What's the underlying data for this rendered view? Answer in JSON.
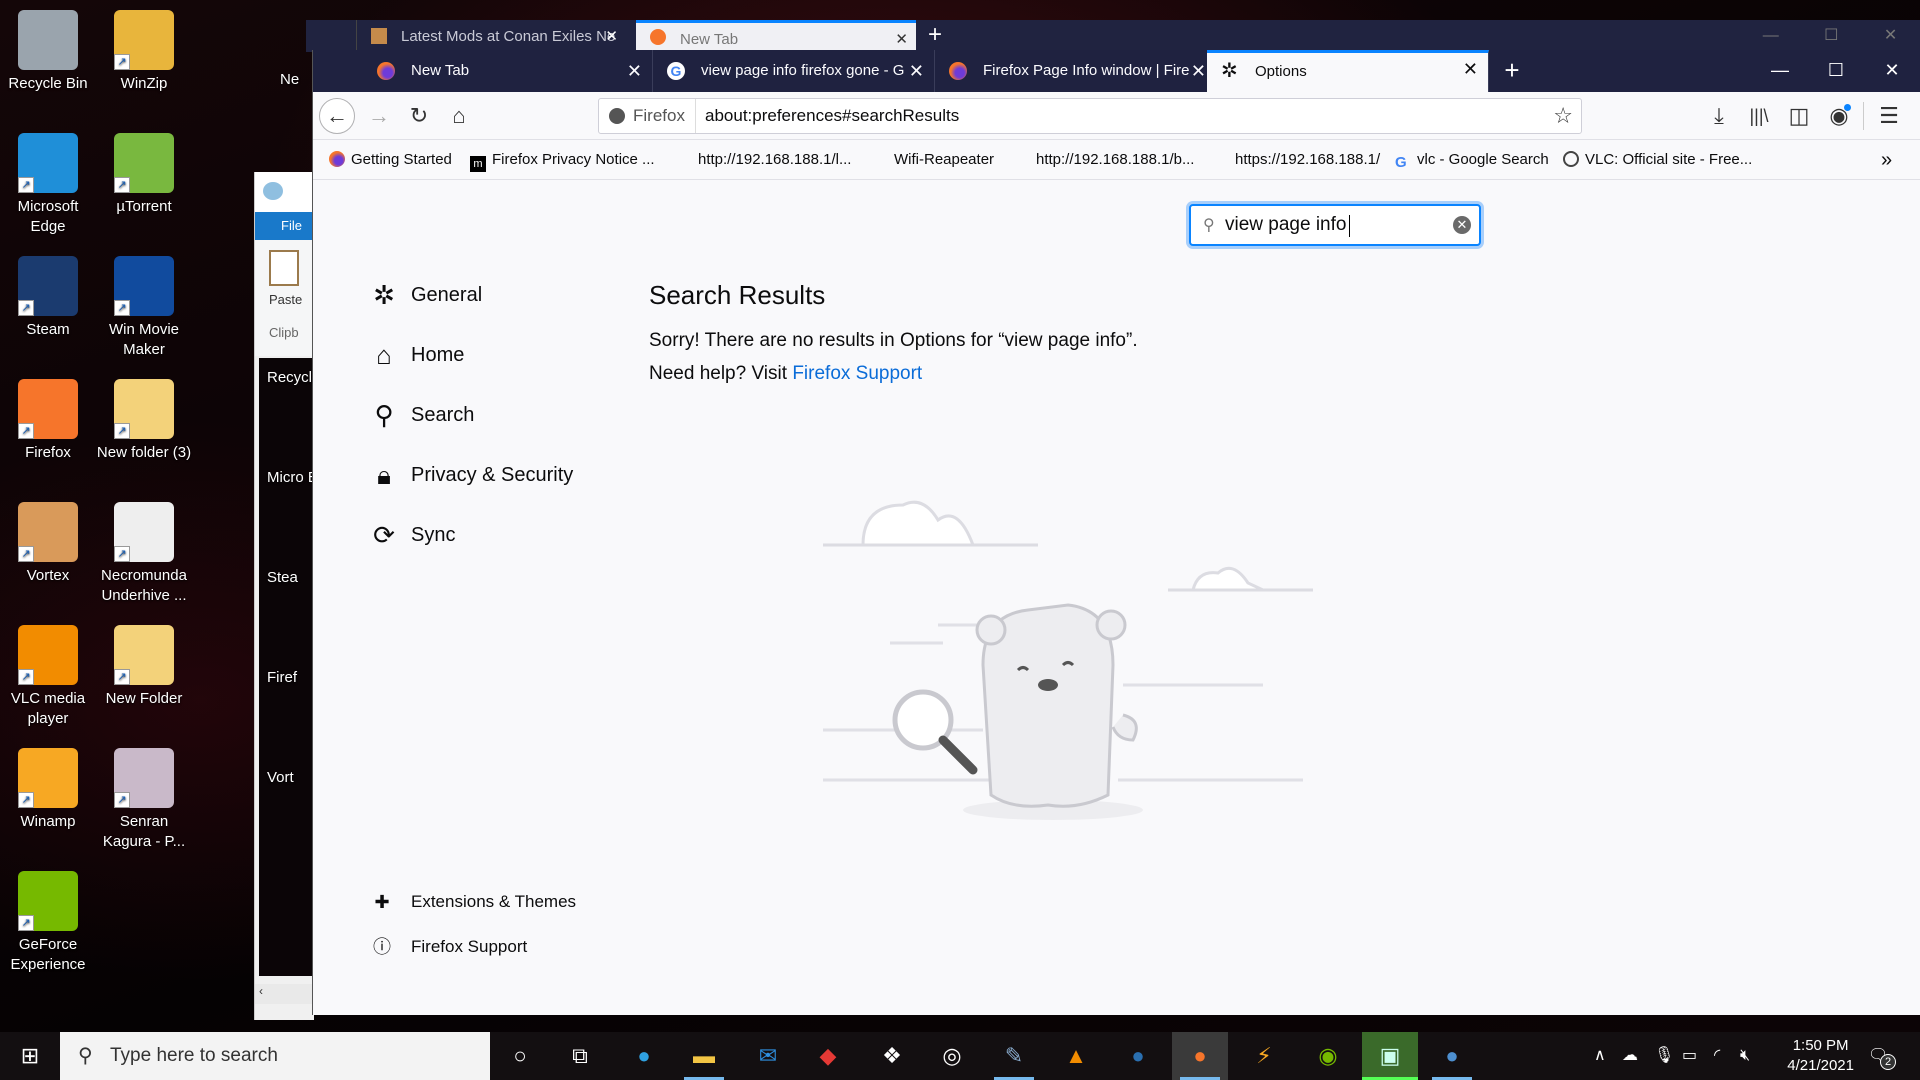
{
  "desktop": {
    "icons": [
      {
        "label": "Recycle Bin",
        "name": "recycle-bin"
      },
      {
        "label": "WinZip",
        "name": "winzip"
      },
      {
        "label": "Microsoft Edge",
        "name": "microsoft-edge"
      },
      {
        "label": "µTorrent",
        "name": "utorrent"
      },
      {
        "label": "Steam",
        "name": "steam"
      },
      {
        "label": "Win Movie Maker",
        "name": "win-movie-maker"
      },
      {
        "label": "Firefox",
        "name": "firefox"
      },
      {
        "label": "New folder (3)",
        "name": "new-folder-3"
      },
      {
        "label": "Vortex",
        "name": "vortex"
      },
      {
        "label": "Necromunda Underhive ...",
        "name": "necromunda"
      },
      {
        "label": "VLC media player",
        "name": "vlc"
      },
      {
        "label": "New Folder",
        "name": "new-folder"
      },
      {
        "label": "Winamp",
        "name": "winamp"
      },
      {
        "label": "Senran Kagura - P...",
        "name": "senran-kagura"
      },
      {
        "label": "GeForce Experience",
        "name": "geforce-experience"
      }
    ],
    "partial_label": "Ne"
  },
  "paint_window": {
    "file_label": "File",
    "paste_label": "Paste",
    "group_label": "Clipb",
    "canvas_labels": [
      "Recycle",
      "Micro Edg",
      "Stea",
      "Firef",
      "Vort"
    ]
  },
  "back_browser": {
    "tabs": [
      {
        "title": "Latest Mods at Conan Exiles Ne"
      },
      {
        "title": "New Tab"
      }
    ]
  },
  "browser": {
    "tabs": [
      {
        "title": "New Tab",
        "icon": "firefox-icon"
      },
      {
        "title": "view page info firefox gone - G",
        "icon": "google-icon"
      },
      {
        "title": "Firefox Page Info window | Fire",
        "icon": "firefox-icon"
      },
      {
        "title": "Options",
        "icon": "gear-icon",
        "active": true
      }
    ],
    "url_identity": "Firefox",
    "url": "about:preferences#searchResults",
    "bookmarks": [
      {
        "label": "Getting Started"
      },
      {
        "label": "Firefox Privacy Notice ..."
      },
      {
        "label": "http://192.168.188.1/l..."
      },
      {
        "label": "Wifi-Reapeater"
      },
      {
        "label": "http://192.168.188.1/b..."
      },
      {
        "label": "https://192.168.188.1/"
      },
      {
        "label": "vlc - Google Search"
      },
      {
        "label": "VLC: Official site - Free..."
      }
    ]
  },
  "preferences": {
    "search_value": "view page info",
    "categories": [
      {
        "label": "General",
        "icon": "gear-icon"
      },
      {
        "label": "Home",
        "icon": "home-icon"
      },
      {
        "label": "Search",
        "icon": "search-icon"
      },
      {
        "label": "Privacy & Security",
        "icon": "lock-icon"
      },
      {
        "label": "Sync",
        "icon": "sync-icon"
      }
    ],
    "footer": [
      {
        "label": "Extensions & Themes",
        "icon": "puzzle-icon"
      },
      {
        "label": "Firefox Support",
        "icon": "help-icon"
      }
    ],
    "results_title": "Search Results",
    "no_results": "Sorry! There are no results in Options for “view page info”.",
    "help_prefix": "Need help? Visit ",
    "help_link": "Firefox Support"
  },
  "taskbar": {
    "search_placeholder": "Type here to search",
    "time": "1:50 PM",
    "date": "4/21/2021",
    "notifications": "2"
  },
  "colors": {
    "accent": "#0a84ff",
    "link": "#0a6cd8",
    "tabbar": "#1f2240"
  }
}
